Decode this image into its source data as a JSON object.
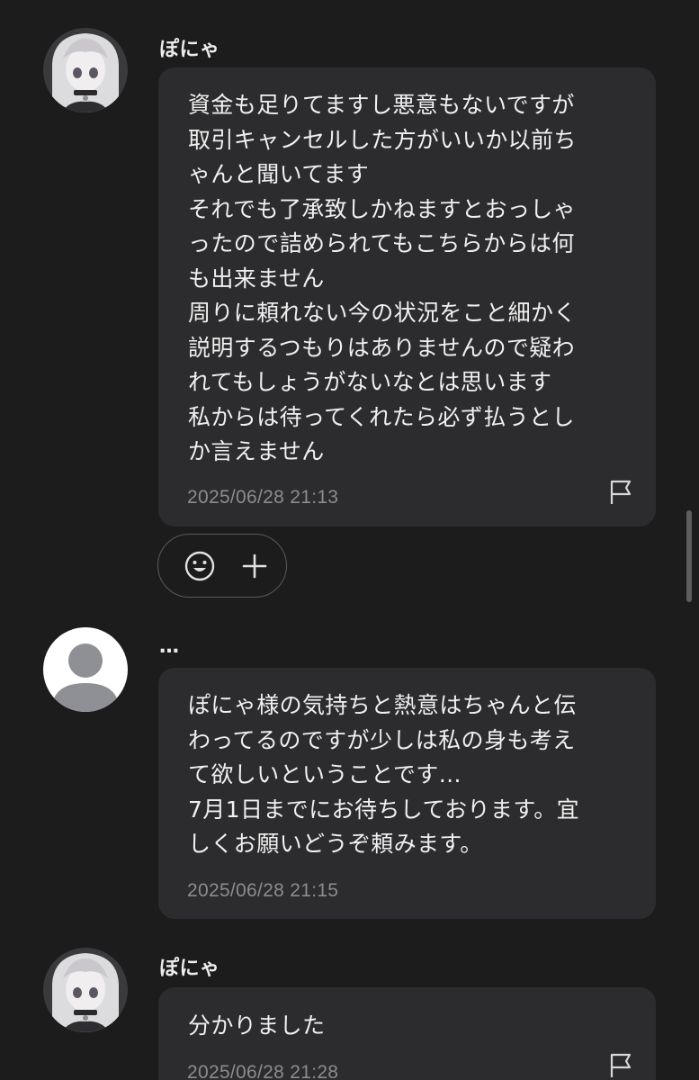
{
  "messages": [
    {
      "sender": "ぽにゃ",
      "text": "資金も足りてますし悪意もないですが\n取引キャンセルした方がいいか以前ち\nゃんと聞いてます\nそれでも了承致しかねますとおっしゃ\nったので詰められてもこちらからは何\nも出来ません\n周りに頼れない今の状況をこと細かく\n説明するつもりはありませんので疑わ\nれてもしょうがないなとは思います\n私からは待ってくれたら必ず払うとし\nか言えません",
      "timestamp": "2025/06/28 21:13",
      "flag_icon": "flag-icon"
    },
    {
      "sender": "…",
      "text": "ぽにゃ様の気持ちと熱意はちゃんと伝\nわってるのですが少しは私の身も考え\nて欲しいということです…\n7月1日までにお待ちしております。宜\nしくお願いどうぞ頼みます。",
      "timestamp": "2025/06/28 21:15"
    },
    {
      "sender": "ぽにゃ",
      "text": "分かりました",
      "timestamp": "2025/06/28 21:28",
      "flag_icon": "flag-icon"
    }
  ],
  "reactions": {
    "emoji_icon": "smiley-icon",
    "add_icon": "plus-icon"
  },
  "colors": {
    "background": "#1c1c1d",
    "bubble": "#2c2c2e",
    "text": "#f0f0f0",
    "timestamp": "#8c8c8e",
    "reaction_border": "#5a5a5c"
  }
}
